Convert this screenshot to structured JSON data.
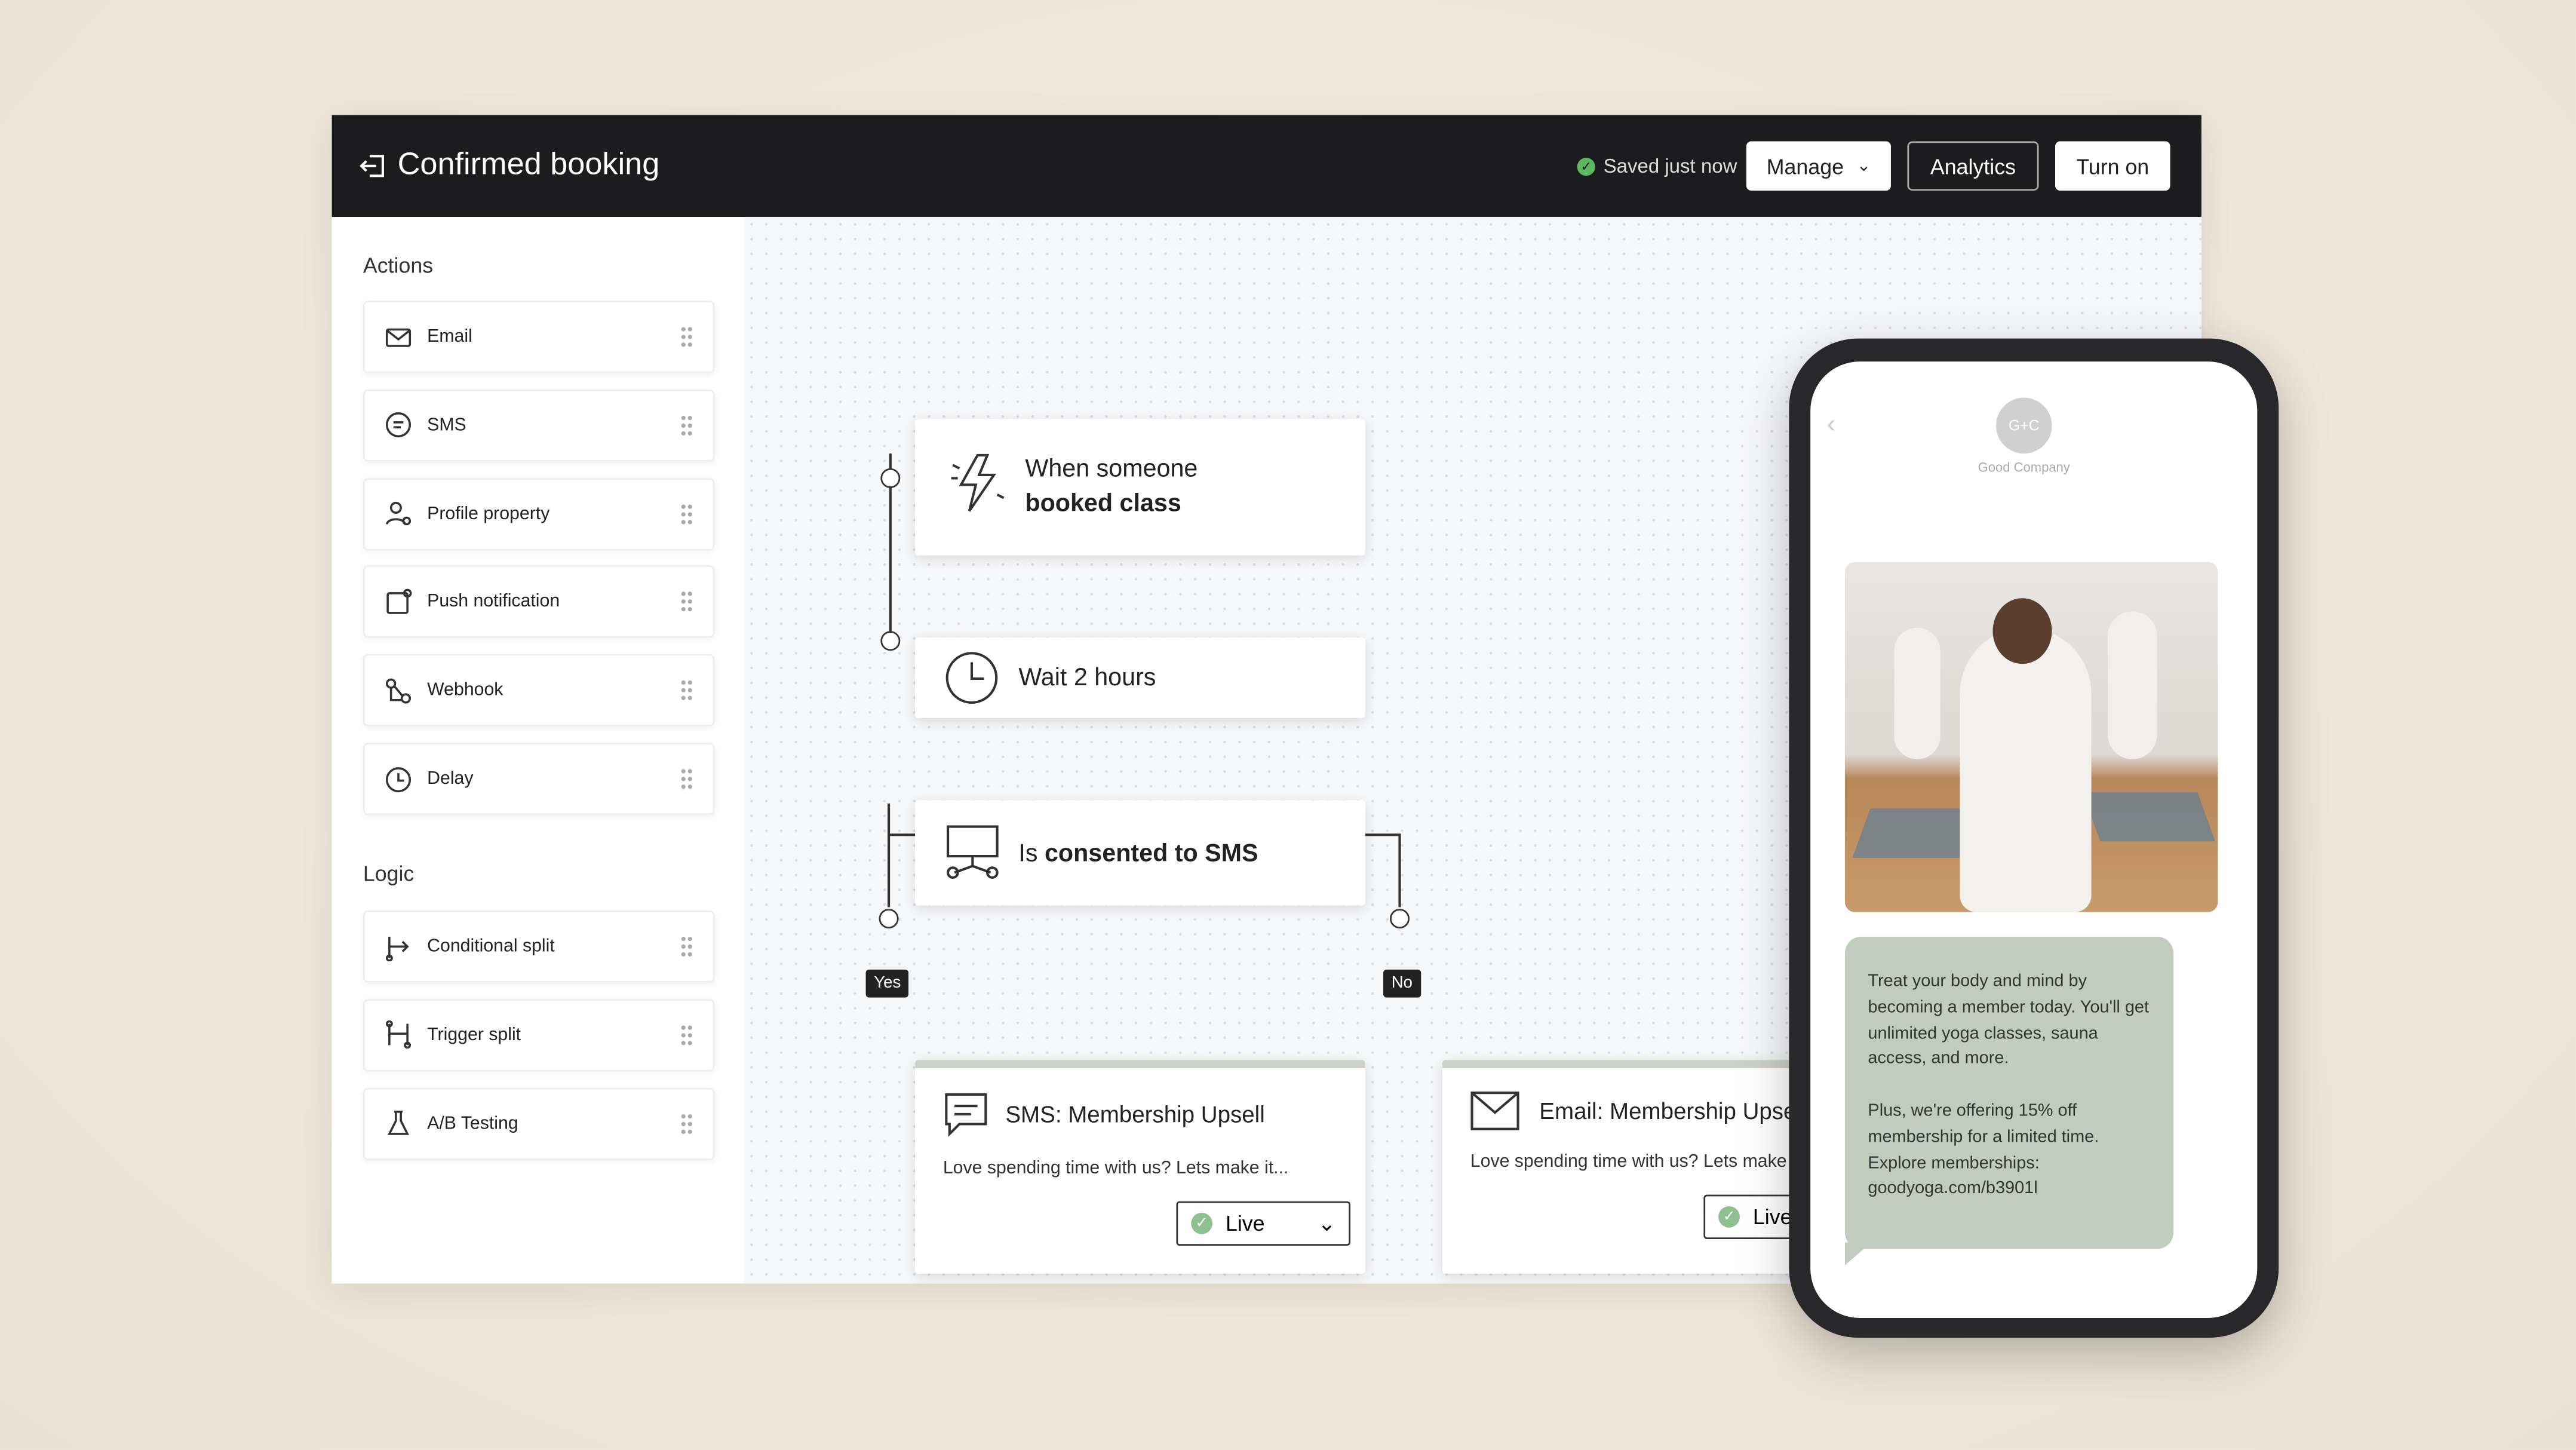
{
  "header": {
    "title": "Confirmed booking",
    "saved": "Saved just now",
    "manage": "Manage",
    "analytics": "Analytics",
    "turn_on": "Turn on"
  },
  "sidebar": {
    "actions_label": "Actions",
    "actions": [
      {
        "label": "Email",
        "icon": "mail-icon"
      },
      {
        "label": "SMS",
        "icon": "chat-icon"
      },
      {
        "label": "Profile property",
        "icon": "user-icon"
      },
      {
        "label": "Push notification",
        "icon": "push-icon"
      },
      {
        "label": "Webhook",
        "icon": "webhook-icon"
      },
      {
        "label": "Delay",
        "icon": "clock-icon"
      }
    ],
    "logic_label": "Logic",
    "logic": [
      {
        "label": "Conditional split",
        "icon": "split-icon"
      },
      {
        "label": "Trigger split",
        "icon": "trigger-split-icon"
      },
      {
        "label": "A/B Testing",
        "icon": "flask-icon"
      }
    ]
  },
  "flow": {
    "trigger_line1": "When someone",
    "trigger_line2": "booked class",
    "wait": "Wait 2 hours",
    "cond_prefix": "Is ",
    "cond_bold": "consented to SMS",
    "yes": "Yes",
    "no": "No",
    "sms_title": "SMS: Membership Upsell",
    "sms_body": "Love spending time with us? Lets make it...",
    "sms_status": "Live",
    "email_title": "Email: Membership Upsell",
    "email_body": "Love spending time with us? Lets make it...",
    "email_status": "Live"
  },
  "phone": {
    "avatar": "G+C",
    "sender": "Good Company",
    "msg_p1": "Treat your body and mind by becoming a member today. You'll get unlimited yoga classes, sauna access, and more.",
    "msg_p2": "Plus, we're offering 15% off membership for a limited time. Explore memberships: goodyoga.com/b3901l"
  },
  "colors": {
    "header_bg": "#1c1c1e",
    "success": "#5cb85c",
    "bubble": "#c2ccbe"
  }
}
